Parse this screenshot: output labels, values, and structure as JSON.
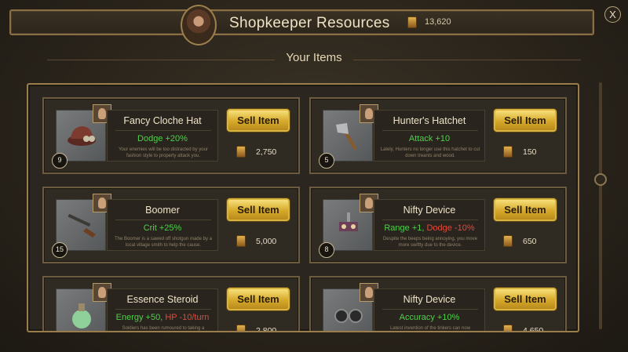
{
  "header": {
    "title": "Shopkeeper Resources",
    "gold": "13,620",
    "portrait_icon": "shopkeeper-portrait-icon",
    "close_label": "X"
  },
  "section": {
    "title": "Your Items"
  },
  "colors": {
    "stat_positive": "#4fd04c",
    "stat_negative": "#e04a3a",
    "button_gold": "#d6a92a"
  },
  "items": [
    {
      "name": "Fancy Cloche Hat",
      "stat": "Dodge +20%",
      "stat_neg": "",
      "desc": "Your enemies will be too distracted by your fashion style to properly attack you.",
      "level": "9",
      "price": "2,750",
      "sell_label": "Sell Item",
      "icon": "cloche-hat-icon"
    },
    {
      "name": "Hunter's Hatchet",
      "stat": "Attack +10",
      "stat_neg": "",
      "desc": "Lately, Hunters no longer use this hatchet to cut down treants and wood.",
      "level": "5",
      "price": "150",
      "sell_label": "Sell Item",
      "icon": "hatchet-icon"
    },
    {
      "name": "Boomer",
      "stat": "Crit +25%",
      "stat_neg": "",
      "desc": "The Boomer is a sawed off shotgun made by a local village smith to help the cause.",
      "level": "15",
      "price": "5,000",
      "sell_label": "Sell Item",
      "icon": "shotgun-icon"
    },
    {
      "name": "Nifty Device",
      "stat": "Range +1, ",
      "stat_neg": "Dodge -10%",
      "desc": "Despite the beeps being annoying, you move more swiftly due to the device.",
      "level": "8",
      "price": "650",
      "sell_label": "Sell Item",
      "icon": "device-icon"
    },
    {
      "name": "Essence Steroid",
      "stat": "Energy +50, ",
      "stat_neg": "HP -10/turn",
      "desc": "Soldiers has been rumoured to taking a",
      "level": "",
      "price": "2,800",
      "sell_label": "Sell Item",
      "icon": "potion-icon"
    },
    {
      "name": "Nifty Device",
      "stat": "Accuracy +10%",
      "stat_neg": "",
      "desc": "Latest invention of the tinkers can now",
      "level": "",
      "price": "4,650",
      "sell_label": "Sell Item",
      "icon": "goggles-icon"
    }
  ]
}
